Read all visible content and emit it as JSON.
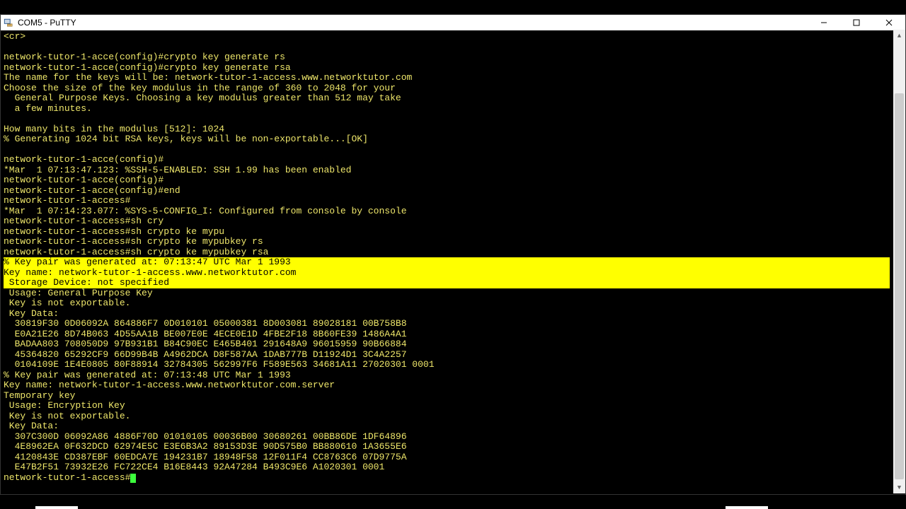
{
  "window": {
    "title": "COM5 - PuTTY"
  },
  "terminal": {
    "lines": [
      {
        "t": "<cr>",
        "hl": false
      },
      {
        "t": "",
        "hl": false
      },
      {
        "t": "network-tutor-1-acce(config)#crypto key generate rs",
        "hl": false
      },
      {
        "t": "network-tutor-1-acce(config)#crypto key generate rsa",
        "hl": false
      },
      {
        "t": "The name for the keys will be: network-tutor-1-access.www.networktutor.com",
        "hl": false
      },
      {
        "t": "Choose the size of the key modulus in the range of 360 to 2048 for your",
        "hl": false
      },
      {
        "t": "  General Purpose Keys. Choosing a key modulus greater than 512 may take",
        "hl": false
      },
      {
        "t": "  a few minutes.",
        "hl": false
      },
      {
        "t": "",
        "hl": false
      },
      {
        "t": "How many bits in the modulus [512]: 1024",
        "hl": false
      },
      {
        "t": "% Generating 1024 bit RSA keys, keys will be non-exportable...[OK]",
        "hl": false
      },
      {
        "t": "",
        "hl": false
      },
      {
        "t": "network-tutor-1-acce(config)#",
        "hl": false
      },
      {
        "t": "*Mar  1 07:13:47.123: %SSH-5-ENABLED: SSH 1.99 has been enabled",
        "hl": false
      },
      {
        "t": "network-tutor-1-acce(config)#",
        "hl": false
      },
      {
        "t": "network-tutor-1-acce(config)#end",
        "hl": false
      },
      {
        "t": "network-tutor-1-access#",
        "hl": false
      },
      {
        "t": "*Mar  1 07:14:23.077: %SYS-5-CONFIG_I: Configured from console by console",
        "hl": false
      },
      {
        "t": "network-tutor-1-access#sh cry",
        "hl": false
      },
      {
        "t": "network-tutor-1-access#sh crypto ke mypu",
        "hl": false
      },
      {
        "t": "network-tutor-1-access#sh crypto ke mypubkey rs",
        "hl": false
      },
      {
        "t": "network-tutor-1-access#sh crypto ke mypubkey rsa",
        "hl": false
      },
      {
        "t": "% Key pair was generated at: 07:13:47 UTC Mar 1 1993",
        "hl": true
      },
      {
        "t": "Key name: network-tutor-1-access.www.networktutor.com",
        "hl": true
      },
      {
        "t": " Storage Device: not specified",
        "hl": true
      },
      {
        "t": " Usage: General Purpose Key",
        "hl": false
      },
      {
        "t": " Key is not exportable.",
        "hl": false
      },
      {
        "t": " Key Data:",
        "hl": false
      },
      {
        "t": "  30819F30 0D06092A 864886F7 0D010101 05000381 8D003081 89028181 00B758B8",
        "hl": false
      },
      {
        "t": "  E0A21E26 8D74B063 4D55AA1B BE007E0E 4ECE0E1D 4FBE2F18 8B60FE39 1486A4A1",
        "hl": false
      },
      {
        "t": "  BADAA803 708050D9 97B931B1 B84C90EC E465B401 291648A9 96015959 90B66884",
        "hl": false
      },
      {
        "t": "  45364820 65292CF9 66D99B4B A4962DCA D8F587AA 1DAB777B D11924D1 3C4A2257",
        "hl": false
      },
      {
        "t": "  0104109E 1E4E0805 80F88914 32784305 562997F6 F589E563 34681A11 27020301 0001",
        "hl": false
      },
      {
        "t": "% Key pair was generated at: 07:13:48 UTC Mar 1 1993",
        "hl": false
      },
      {
        "t": "Key name: network-tutor-1-access.www.networktutor.com.server",
        "hl": false
      },
      {
        "t": "Temporary key",
        "hl": false
      },
      {
        "t": " Usage: Encryption Key",
        "hl": false
      },
      {
        "t": " Key is not exportable.",
        "hl": false
      },
      {
        "t": " Key Data:",
        "hl": false
      },
      {
        "t": "  307C300D 06092A86 4886F70D 01010105 00036B00 30680261 00BB86DE 1DF64896",
        "hl": false
      },
      {
        "t": "  4E8962EA 0F632DCD 62974E5C E3E6B3A2 89153D3E 90D575B0 BB880610 1A3655E6",
        "hl": false
      },
      {
        "t": "  4120843E CD387EBF 60EDCA7E 194231B7 18948F58 12F011F4 CC8763C6 07D9775A",
        "hl": false
      },
      {
        "t": "  E47B2F51 73932E26 FC722CE4 B16E8443 92A47284 B493C9E6 A1020301 0001",
        "hl": false
      }
    ],
    "prompt": "network-tutor-1-access#"
  }
}
